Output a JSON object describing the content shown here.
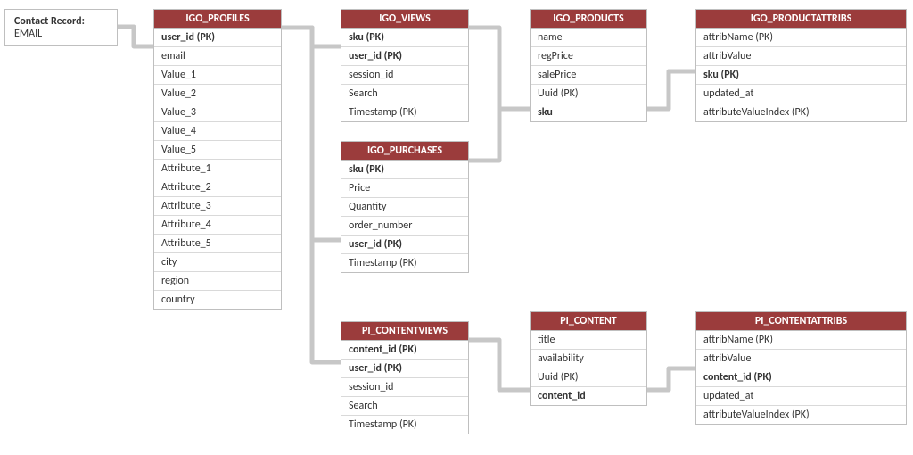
{
  "colors": {
    "header_bg": "#9b3c3c",
    "header_fg": "#ffffff",
    "border": "#bfbfbf",
    "row_border": "#d9d9d9",
    "connector": "#c7c7c7"
  },
  "contact_record": {
    "label": "Contact Record:",
    "value": "EMAIL"
  },
  "tables": {
    "profiles": {
      "title": "IGO_PROFILES",
      "fields": [
        {
          "name": "user_id (PK)",
          "bold": true
        },
        {
          "name": "email"
        },
        {
          "name": "Value_1"
        },
        {
          "name": "Value_2"
        },
        {
          "name": "Value_3"
        },
        {
          "name": "Value_4"
        },
        {
          "name": "Value_5"
        },
        {
          "name": "Attribute_1"
        },
        {
          "name": "Attribute_2"
        },
        {
          "name": "Attribute_3"
        },
        {
          "name": "Attribute_4"
        },
        {
          "name": "Attribute_5"
        },
        {
          "name": "city"
        },
        {
          "name": "region"
        },
        {
          "name": "country"
        }
      ]
    },
    "views": {
      "title": "IGO_VIEWS",
      "fields": [
        {
          "name": "sku (PK)",
          "bold": true
        },
        {
          "name": "user_id (PK)",
          "bold": true
        },
        {
          "name": "session_id"
        },
        {
          "name": "Search"
        },
        {
          "name": "Timestamp (PK)"
        }
      ]
    },
    "purchases": {
      "title": "IGO_PURCHASES",
      "fields": [
        {
          "name": "sku (PK)",
          "bold": true
        },
        {
          "name": "Price"
        },
        {
          "name": "Quantity"
        },
        {
          "name": "order_number"
        },
        {
          "name": "user_id (PK)",
          "bold": true
        },
        {
          "name": "Timestamp (PK)"
        }
      ]
    },
    "contentviews": {
      "title": "PI_CONTENTVIEWS",
      "fields": [
        {
          "name": "content_id (PK)",
          "bold": true
        },
        {
          "name": "user_id (PK)",
          "bold": true
        },
        {
          "name": "session_id"
        },
        {
          "name": "Search"
        },
        {
          "name": "Timestamp (PK)"
        }
      ]
    },
    "products": {
      "title": "IGO_PRODUCTS",
      "fields": [
        {
          "name": "name"
        },
        {
          "name": "regPrice"
        },
        {
          "name": "salePrice"
        },
        {
          "name": "Uuid (PK)"
        },
        {
          "name": "sku",
          "bold": true
        }
      ]
    },
    "content": {
      "title": "PI_CONTENT",
      "fields": [
        {
          "name": "title"
        },
        {
          "name": "availability"
        },
        {
          "name": "Uuid (PK)"
        },
        {
          "name": "content_id",
          "bold": true
        }
      ]
    },
    "productattribs": {
      "title": "IGO_PRODUCTATTRIBS",
      "fields": [
        {
          "name": "attribName (PK)"
        },
        {
          "name": "attribValue"
        },
        {
          "name": "sku  (PK)",
          "bold": true
        },
        {
          "name": "updated_at"
        },
        {
          "name": "attributeValueIndex (PK)"
        }
      ]
    },
    "contentattribs": {
      "title": "PI_CONTENTATTRIBS",
      "fields": [
        {
          "name": "attribName (PK)"
        },
        {
          "name": "attribValue"
        },
        {
          "name": "content_id (PK)",
          "bold": true
        },
        {
          "name": "updated_at"
        },
        {
          "name": "attributeValueIndex (PK)"
        }
      ]
    }
  },
  "relationships": [
    {
      "from": "contact_record.EMAIL",
      "to": "profiles.email"
    },
    {
      "from": "profiles.user_id",
      "to": "views.user_id"
    },
    {
      "from": "profiles.user_id",
      "to": "purchases.user_id"
    },
    {
      "from": "profiles.user_id",
      "to": "contentviews.user_id"
    },
    {
      "from": "views.sku",
      "to": "products.sku"
    },
    {
      "from": "purchases.sku",
      "to": "products.sku"
    },
    {
      "from": "products.sku",
      "to": "productattribs.sku"
    },
    {
      "from": "contentviews.content_id",
      "to": "content.content_id"
    },
    {
      "from": "content.content_id",
      "to": "contentattribs.content_id"
    }
  ]
}
